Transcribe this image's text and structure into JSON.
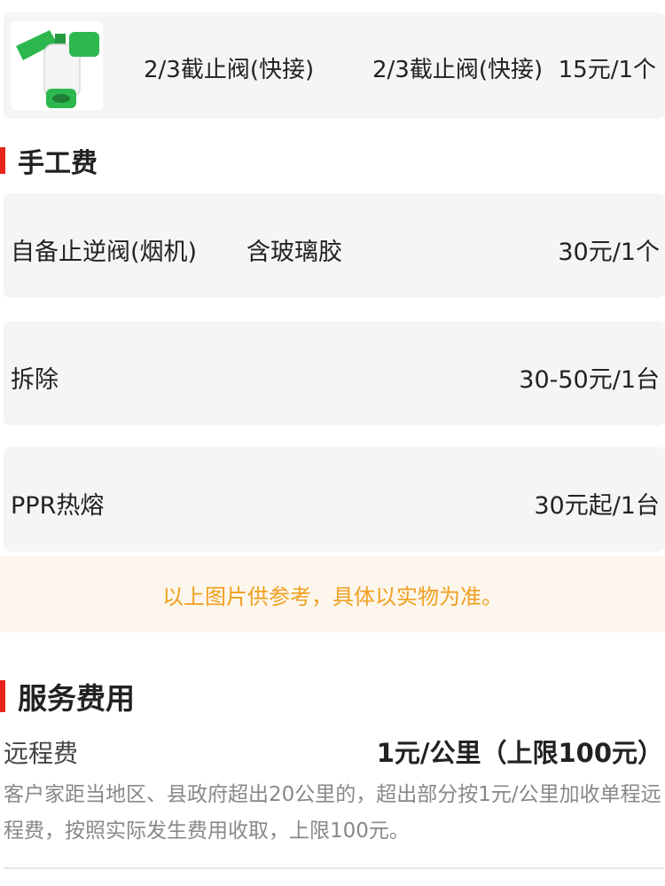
{
  "product": {
    "name_left": "2/3截止阀(快接)",
    "name_right": "2/3截止阀(快接)",
    "price": "15元/1个",
    "image_icon": "green-valve-icon"
  },
  "labor_section": {
    "title": "手工费"
  },
  "labor_fees": [
    {
      "label": "自备止逆阀(烟机)",
      "extra": "含玻璃胶",
      "price": "30元/1个"
    },
    {
      "label": "拆除",
      "extra": "",
      "price": "30-50元/1台"
    },
    {
      "label": "PPR热熔",
      "extra": "",
      "price": "30元起/1台"
    }
  ],
  "notice": {
    "text": "以上图片供参考，具体以实物为准。"
  },
  "service_section": {
    "title": "服务费用"
  },
  "remote_fee": {
    "label": "远程费",
    "price": "1元/公里（上限100元）",
    "description": "客户家距当地区、县政府超出20公里的，超出部分按1元/公里加收单程远程费，按照实际发生费用收取，上限100元。"
  },
  "colors": {
    "accent_red": "#e8231a",
    "notice_orange": "#f0a020",
    "notice_bg": "#fdf6ec",
    "card_bg": "#f5f5f5",
    "valve_green": "#2db84f"
  }
}
